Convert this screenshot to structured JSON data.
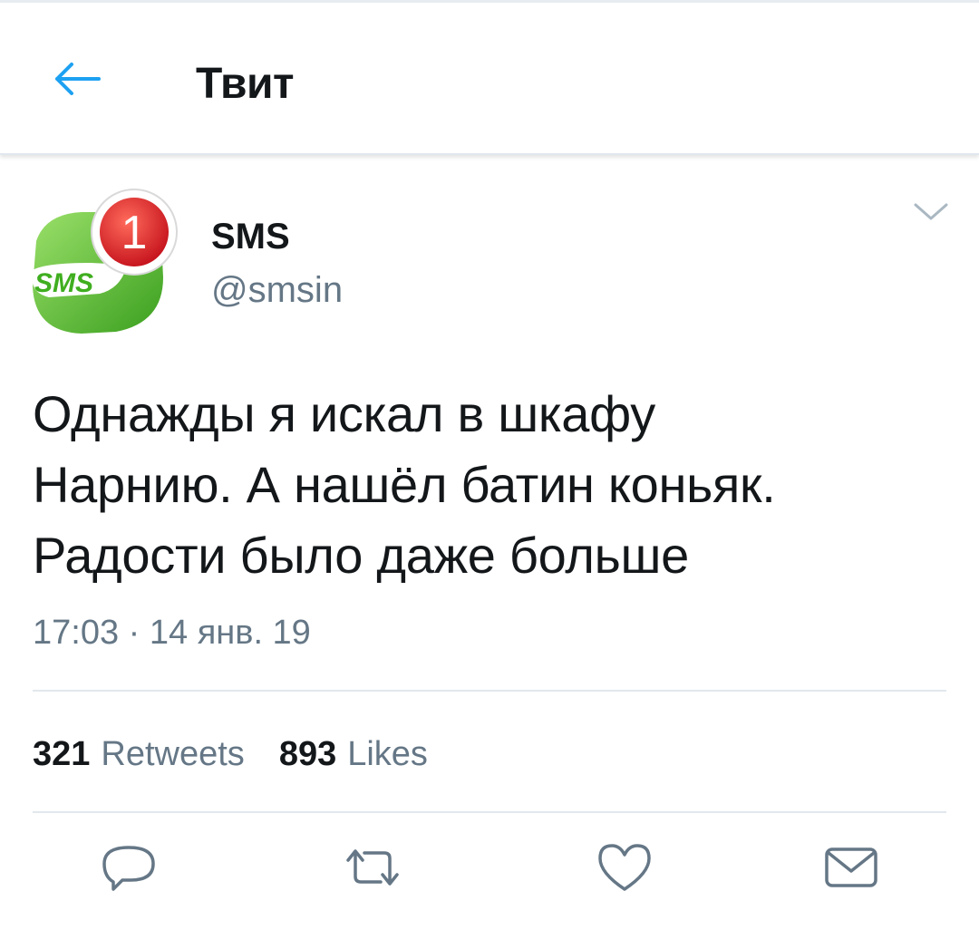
{
  "header": {
    "back_icon": "arrow-left-icon",
    "title": "Твит"
  },
  "author": {
    "name": "SMS",
    "handle": "@smsin",
    "avatar": {
      "badge_number": "1",
      "logo_text": "SMS"
    }
  },
  "tweet": {
    "lines": [
      "Однажды я искал в шкафу",
      "Нарнию. А нашёл батин коньяк.",
      "Радости было даже больше"
    ],
    "timestamp": "17:03 · 14 янв. 19"
  },
  "stats": {
    "retweets": {
      "count": "321",
      "label": "Retweets"
    },
    "likes": {
      "count": "893",
      "label": "Likes"
    }
  },
  "actions": [
    "reply-icon",
    "retweet-icon",
    "like-icon",
    "share-message-icon"
  ],
  "colors": {
    "accent": "#1da1f2",
    "secondary_text": "#657786",
    "primary_text": "#14171a",
    "divider": "#e1e8ed",
    "icon": "#657786",
    "badge_red": "#e02a2a",
    "logo_green": "#5bbf2f"
  }
}
